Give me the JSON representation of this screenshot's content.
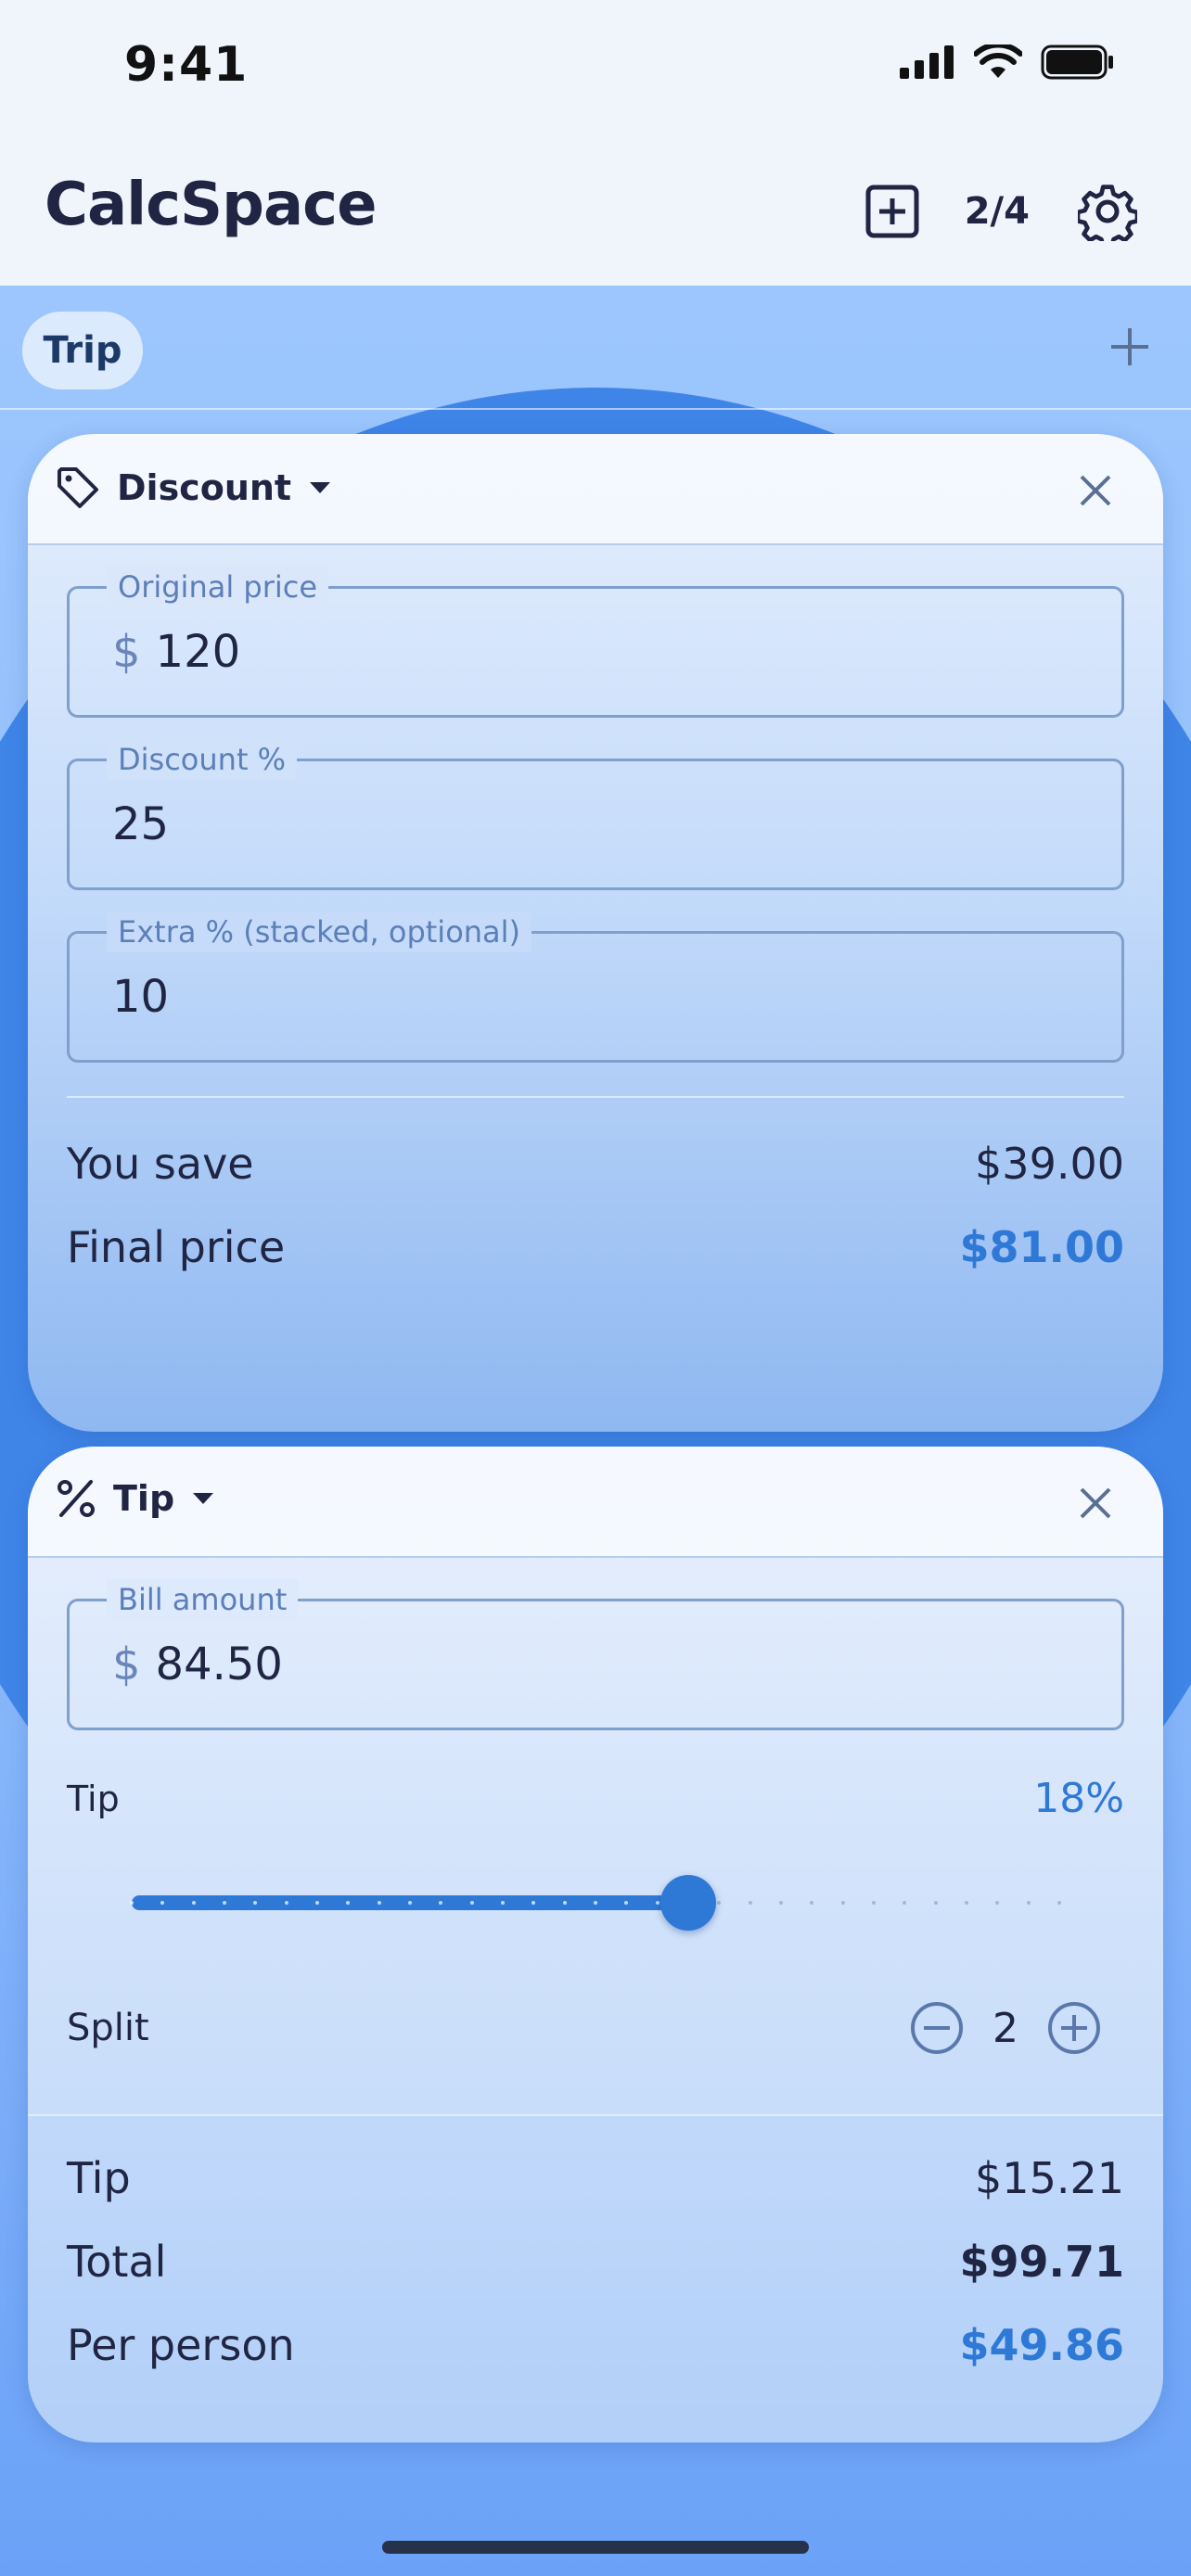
{
  "status_bar": {
    "time": "9:41"
  },
  "header": {
    "title": "CalcSpace",
    "page_indicator": "2/4",
    "add_icon": "plus-square-icon",
    "settings_icon": "gear-icon"
  },
  "tabs": [
    {
      "label": "Trip",
      "active": true
    }
  ],
  "discount_card": {
    "icon": "tag-icon",
    "title": "Discount",
    "fields": {
      "original_price": {
        "label": "Original price",
        "prefix": "$",
        "value": "120"
      },
      "discount_percent": {
        "label": "Discount %",
        "value": "25"
      },
      "extra_percent": {
        "label": "Extra % (stacked, optional)",
        "value": "10"
      }
    },
    "results": {
      "you_save_label": "You save",
      "you_save_value": "$39.00",
      "final_price_label": "Final price",
      "final_price_value": "$81.00"
    }
  },
  "tip_card": {
    "icon": "percent-icon",
    "title": "Tip",
    "bill": {
      "label": "Bill amount",
      "prefix": "$",
      "value": "84.50"
    },
    "tip_label": "Tip",
    "tip_percent_text": "18%",
    "slider": {
      "value": 18,
      "min": 0,
      "max": 30,
      "step": 1
    },
    "split": {
      "label": "Split",
      "value": "2"
    },
    "results": {
      "tip_label": "Tip",
      "tip_value": "$15.21",
      "total_label": "Total",
      "total_value": "$99.71",
      "per_person_label": "Per person",
      "per_person_value": "$49.86"
    }
  },
  "colors": {
    "accent": "#2f79d6",
    "text": "#1f2542",
    "background": "#f0f5fc",
    "blob": "#3f85e8"
  }
}
